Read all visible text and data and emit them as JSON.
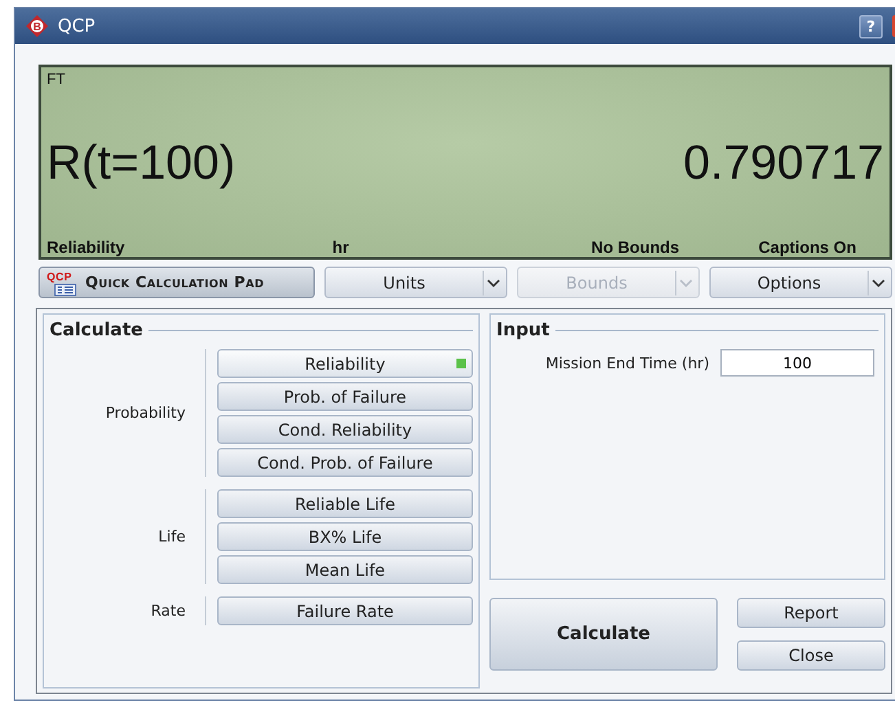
{
  "window": {
    "title": "QCP",
    "logo_letter": "B",
    "help_button": "?"
  },
  "display": {
    "corner_label": "FT",
    "expression": "R(t=100)",
    "value": "0.790717",
    "captions": [
      "Reliability",
      "hr",
      "No Bounds",
      "Captions On"
    ]
  },
  "toolbar": {
    "pad_button": {
      "icon_text": "QCP",
      "label": "Quick Calculation Pad"
    },
    "dropdowns": [
      {
        "label": "Units",
        "disabled": false
      },
      {
        "label": "Bounds",
        "disabled": true
      },
      {
        "label": "Options",
        "disabled": false
      }
    ]
  },
  "calculate": {
    "title": "Calculate",
    "groups": [
      {
        "label": "Probability",
        "options": [
          {
            "label": "Reliability",
            "selected": true
          },
          {
            "label": "Prob. of Failure",
            "selected": false
          },
          {
            "label": "Cond. Reliability",
            "selected": false
          },
          {
            "label": "Cond. Prob. of Failure",
            "selected": false
          }
        ]
      },
      {
        "label": "Life",
        "options": [
          {
            "label": "Reliable Life",
            "selected": false
          },
          {
            "label": "BX% Life",
            "selected": false
          },
          {
            "label": "Mean Life",
            "selected": false
          }
        ]
      },
      {
        "label": "Rate",
        "options": [
          {
            "label": "Failure Rate",
            "selected": false
          }
        ]
      }
    ]
  },
  "input": {
    "title": "Input",
    "fields": [
      {
        "label": "Mission End Time (hr)",
        "value": "100"
      }
    ]
  },
  "actions": {
    "calculate": "Calculate",
    "report": "Report",
    "close": "Close"
  }
}
